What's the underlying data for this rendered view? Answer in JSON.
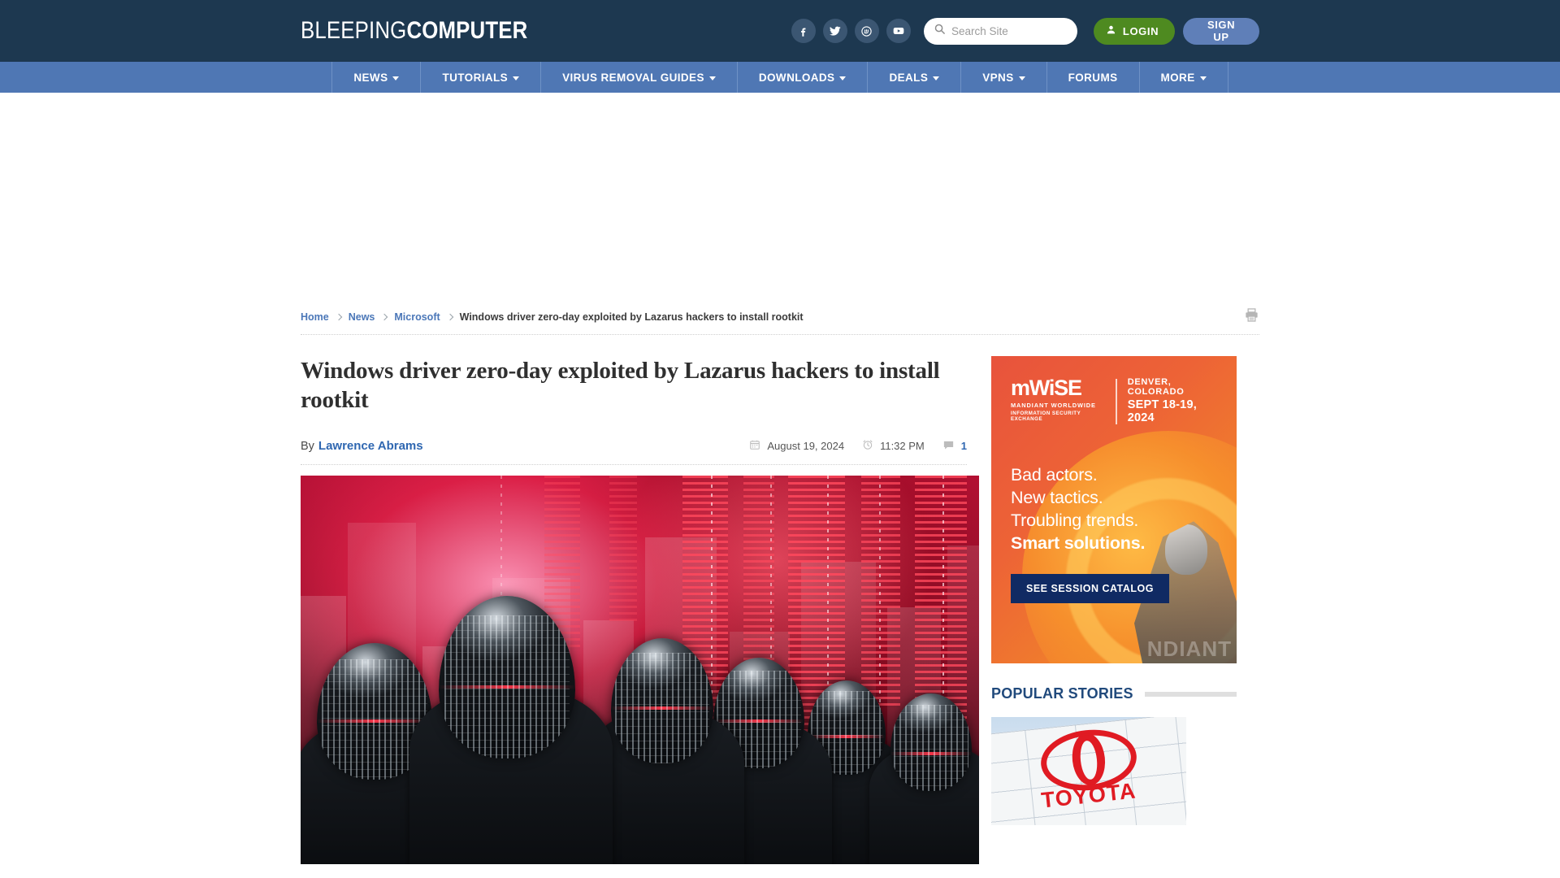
{
  "header": {
    "logo_light": "BLEEPING",
    "logo_bold": "COMPUTER",
    "social": [
      {
        "name": "facebook-icon",
        "label": "f"
      },
      {
        "name": "twitter-icon",
        "label": "t"
      },
      {
        "name": "mastodon-icon",
        "label": "m"
      },
      {
        "name": "youtube-icon",
        "label": "y"
      }
    ],
    "search": {
      "placeholder": "Search Site",
      "value": "",
      "icon": "search-icon"
    },
    "login_label": "LOGIN",
    "signup_label": "SIGN UP",
    "login_color": "#4e8a20",
    "signup_color": "#5f7fb8",
    "bar_color": "#1d3850"
  },
  "nav": {
    "bar_color": "#4f77b4",
    "items": [
      {
        "label": "NEWS",
        "has_caret": true
      },
      {
        "label": "TUTORIALS",
        "has_caret": true
      },
      {
        "label": "VIRUS REMOVAL GUIDES",
        "has_caret": true
      },
      {
        "label": "DOWNLOADS",
        "has_caret": true
      },
      {
        "label": "DEALS",
        "has_caret": true
      },
      {
        "label": "VPNS",
        "has_caret": true
      },
      {
        "label": "FORUMS",
        "has_caret": false
      },
      {
        "label": "MORE",
        "has_caret": true
      }
    ]
  },
  "breadcrumb": {
    "items": [
      "Home",
      "News",
      "Microsoft"
    ],
    "current": "Windows driver zero-day exploited by Lazarus hackers to install rootkit",
    "print_icon": "printer-icon"
  },
  "article": {
    "headline": "Windows driver zero-day exploited by Lazarus hackers to install rootkit",
    "by_label": "By",
    "author": "Lawrence Abrams",
    "date": "August 19, 2024",
    "time": "11:32 PM",
    "comment_count": "1",
    "hero_alt": "Masked hackers with reflective helmets before a red neon cityscape"
  },
  "sidebar": {
    "ad": {
      "brand": "mWiSE",
      "brand_sub1": "MANDIANT WORLDWIDE",
      "brand_sub2": "INFORMATION SECURITY EXCHANGE",
      "city": "DENVER, COLORADO",
      "dates": "SEPT 18-19, 2024",
      "lines": [
        "Bad actors.",
        "New tactics.",
        "Troubling trends."
      ],
      "line_strong": "Smart solutions.",
      "cta": "SEE SESSION CATALOG",
      "ghost_text": "NDIANT",
      "cta_color": "#102a63"
    },
    "popular": {
      "title": "POPULAR STORIES",
      "thumb_brand": "TOYOTA"
    }
  }
}
